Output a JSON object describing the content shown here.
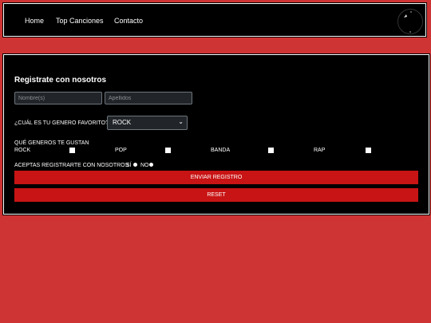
{
  "nav": {
    "items": [
      "Home",
      "Top Canciones",
      "Contacto"
    ]
  },
  "form": {
    "title": "Registrate con nosotros",
    "first_name_placeholder": "Nombre(s)",
    "last_name_placeholder": "Apellidos",
    "genre_question": "¿CUÁL ES TU GENERO FAVORITO?",
    "genre_selected": "ROCK",
    "genres_question": "QUÉ GENEROS TE GUSTAN",
    "genres": [
      "ROCK",
      "POP",
      "BANDA",
      "RAP"
    ],
    "accept_question": "ACEPTAS REGISTRARTE CON NOSOTROS",
    "yes_label": "SÍ",
    "no_label": "NO",
    "submit_label": "ENVIAR REGISTRO",
    "reset_label": "RESET"
  },
  "colors": {
    "page_background": "#cf3434",
    "panel_background": "#000000",
    "button": "#c81414"
  },
  "icons": {
    "logo": "logo-icon"
  }
}
